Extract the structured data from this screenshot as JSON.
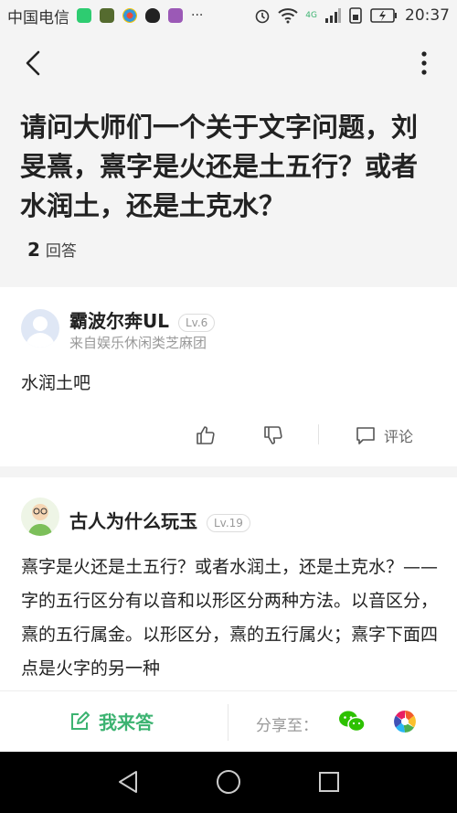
{
  "status_bar": {
    "carrier": "中国电信",
    "more_indicator": "···",
    "network_label": "4G",
    "time": "20:37"
  },
  "question": {
    "title": "请问大师们一个关于文字问题，刘旻熹，熹字是火还是土五行？或者水润土，还是土克水？",
    "answer_count": "2",
    "answer_count_label": "回答"
  },
  "answers": [
    {
      "username": "霸波尔奔UL",
      "level": "Lv.6",
      "source": "来自娱乐休闲类芝麻团",
      "content": "水润土吧",
      "comment_label": "评论"
    },
    {
      "username": "古人为什么玩玉",
      "level": "Lv.19",
      "content": "熹字是火还是土五行？或者水润土，还是土克水？——字的五行区分有以音和以形区分两种方法。以音区分，熹的五行属金。以形区分，熹的五行属火；熹字下面四点是火字的另一种"
    }
  ],
  "bottom_bar": {
    "write_label": "我来答",
    "share_label": "分享至："
  },
  "colors": {
    "accent_green": "#3cb371",
    "wechat_green": "#2dc100"
  }
}
